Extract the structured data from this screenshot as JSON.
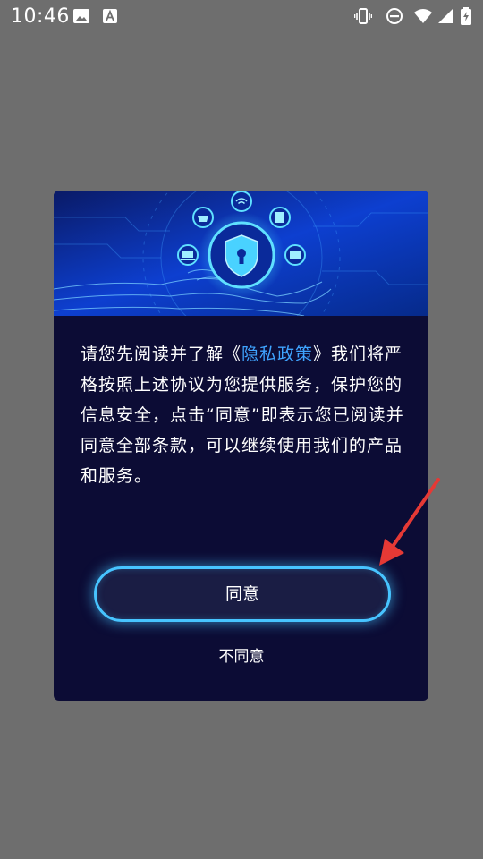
{
  "status_bar": {
    "time": "10:46",
    "left_icons": [
      "image-icon",
      "a-box-icon"
    ],
    "right_icons": [
      "vibrate-icon",
      "do-not-disturb-icon",
      "wifi-icon",
      "signal-icon",
      "battery-icon"
    ]
  },
  "dialog": {
    "banner_icons": [
      "wifi-icon",
      "basket-icon",
      "document-icon",
      "laptop-icon",
      "wallet-icon",
      "shield-lock-icon"
    ],
    "text_before": "请您先阅读并了解《",
    "policy_link": "隐私政策",
    "text_after": "》我们将严格按照上述协议为您提供服务，保护您的信息安全，点击“同意”即表示您已阅读并同意全部条款，可以继续使用我们的产品和服务。",
    "agree_label": "同意",
    "disagree_label": "不同意"
  },
  "colors": {
    "overlay": "#6e6e6e",
    "dialog_bg": "#0c0c35",
    "link": "#3fa4ff",
    "button_border": "#47c4ff",
    "arrow": "#e53935"
  }
}
